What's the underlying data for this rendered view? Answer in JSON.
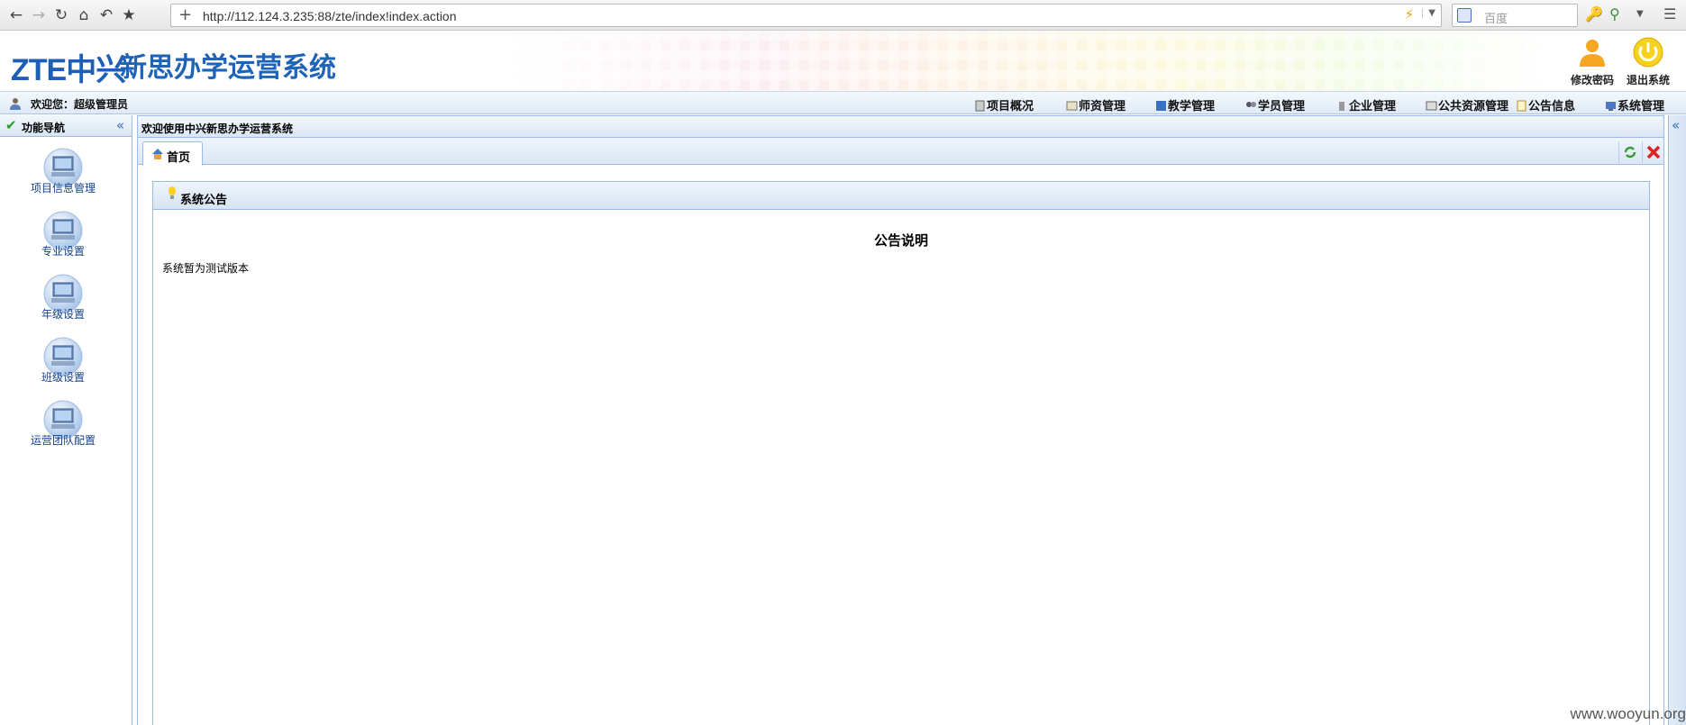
{
  "browser": {
    "url": "http://112.124.3.235:88/zte/index!index.action",
    "search_placeholder": "百度"
  },
  "header": {
    "logo": "ZTE中兴",
    "system_title": "新思办学运营系统",
    "actions": [
      {
        "label": "修改密码",
        "icon": "user-key-icon"
      },
      {
        "label": "退出系统",
        "icon": "power-icon"
      }
    ]
  },
  "menubar": {
    "welcome": "欢迎您：超级管理员",
    "items": [
      {
        "label": "项目概况",
        "icon": "project-icon"
      },
      {
        "label": "师资管理",
        "icon": "teacher-icon"
      },
      {
        "label": "教学管理",
        "icon": "teaching-icon"
      },
      {
        "label": "学员管理",
        "icon": "students-icon"
      },
      {
        "label": "企业管理",
        "icon": "enterprise-icon"
      },
      {
        "label": "公共资源管理",
        "icon": "resource-icon"
      },
      {
        "label": "公告信息",
        "icon": "notice-icon"
      },
      {
        "label": "系统管理",
        "icon": "system-icon"
      }
    ]
  },
  "left_nav": {
    "title": "功能导航",
    "items": [
      {
        "label": "项目信息管理"
      },
      {
        "label": "专业设置"
      },
      {
        "label": "年级设置"
      },
      {
        "label": "班级设置"
      },
      {
        "label": "运营团队配置"
      }
    ]
  },
  "main": {
    "title": "欢迎使用中兴新思办学运营系统",
    "tab_label": "首页",
    "notice": {
      "header": "系统公告",
      "title": "公告说明",
      "body": "系统暂为测试版本"
    }
  },
  "watermark": "www.wooyun.org",
  "colors": {
    "brand_blue": "#1d63b8",
    "panel_border": "#99bbe8",
    "nav_text": "#15428b"
  }
}
